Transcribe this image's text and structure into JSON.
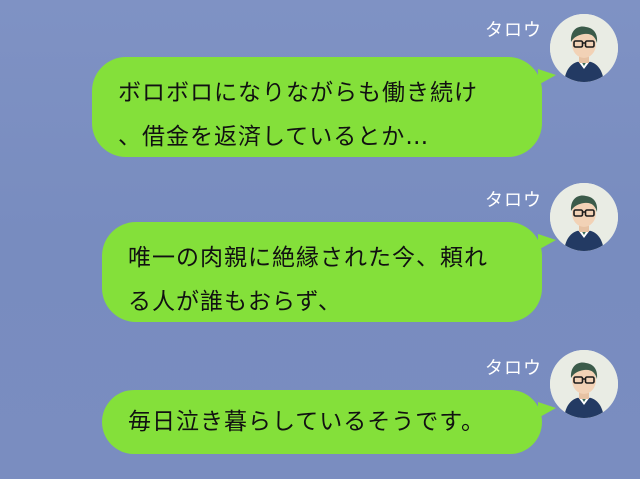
{
  "messages": [
    {
      "sender": "タロウ",
      "lines": [
        "ボロボロになりながらも働き続け",
        "、借金を返済しているとか…"
      ]
    },
    {
      "sender": "タロウ",
      "lines": [
        "唯一の肉親に絶縁された今、頼れ",
        "る人が誰もおらず、"
      ]
    },
    {
      "sender": "タロウ",
      "lines": [
        "毎日泣き暮らしているそうです。"
      ]
    }
  ],
  "colors": {
    "background": "#7b8fc1",
    "bubble": "#84e03a",
    "sender_text": "#ffffff"
  },
  "icons": {
    "avatar": "user-avatar-man-glasses"
  }
}
